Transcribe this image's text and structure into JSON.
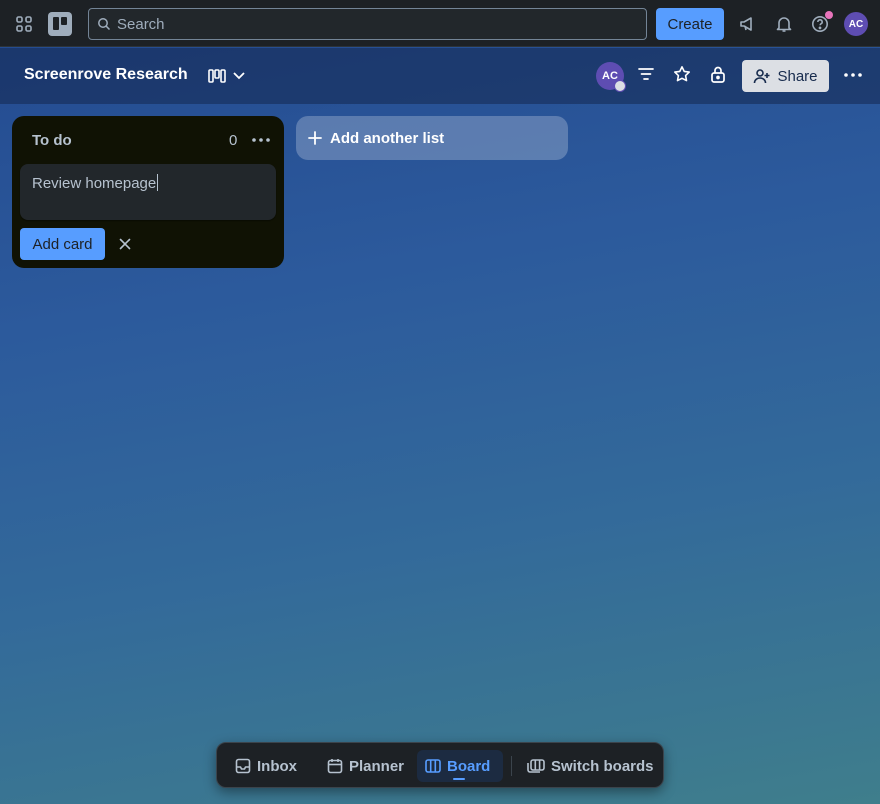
{
  "topbar": {
    "search_placeholder": "Search",
    "create_label": "Create",
    "user_initials": "AC"
  },
  "board": {
    "title": "Screenrove Research",
    "member_initials": "AC",
    "share_label": "Share"
  },
  "lists": [
    {
      "title": "To do",
      "count": "0",
      "draft_card_text": "Review homepage",
      "add_card_label": "Add card"
    }
  ],
  "add_list_label": "Add another list",
  "bottom_nav": {
    "inbox": "Inbox",
    "planner": "Planner",
    "board": "Board",
    "switch_boards": "Switch boards",
    "active": "board"
  },
  "colors": {
    "accent": "#579dff",
    "topbar_bg": "#1d2125",
    "list_bg": "#101204",
    "avatar": "#5e4db2",
    "notification_dot": "#e774bb"
  }
}
